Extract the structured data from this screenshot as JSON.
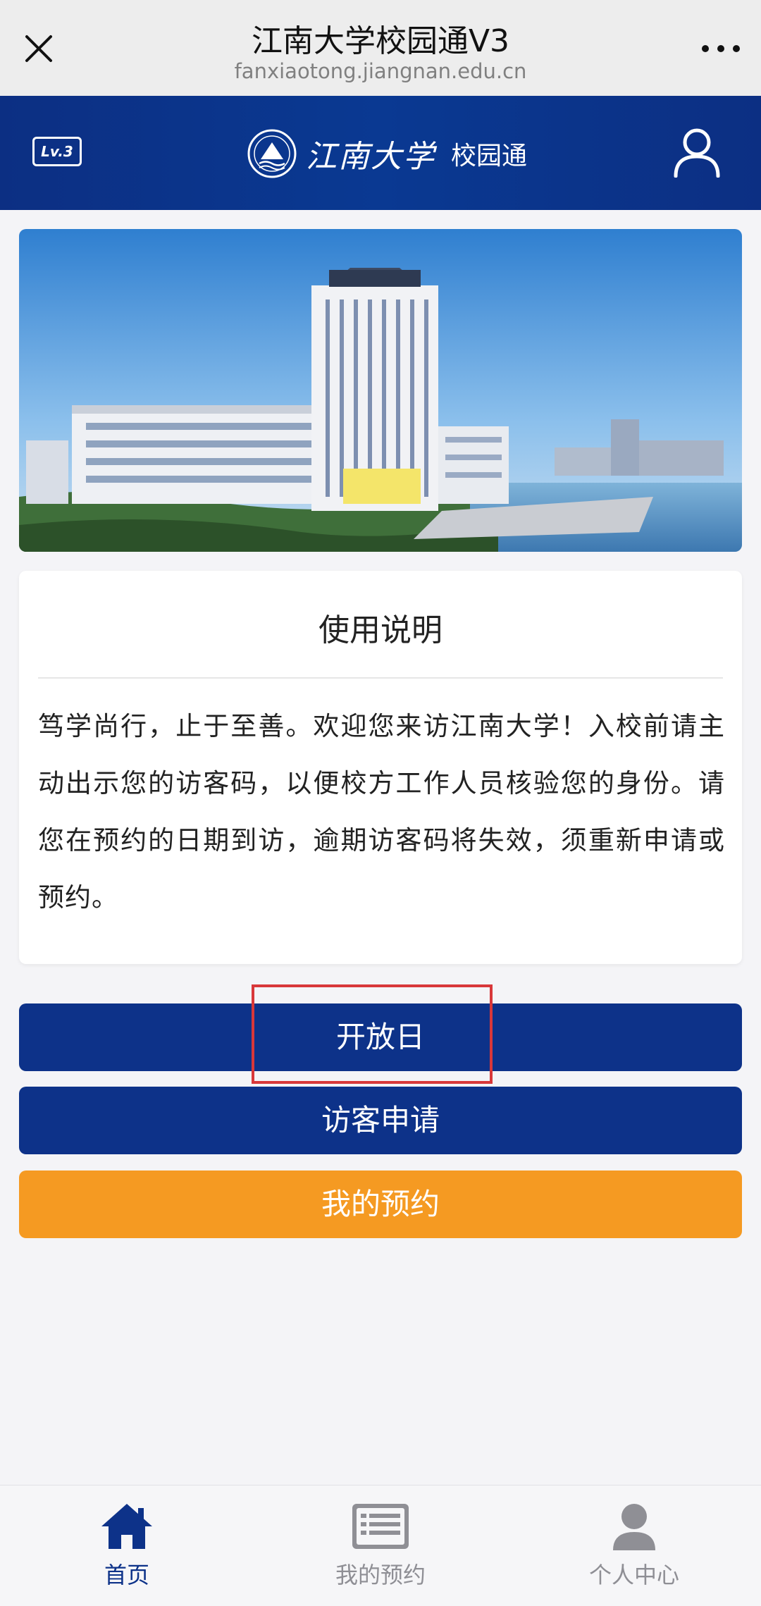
{
  "topbar": {
    "title": "江南大学校园通V3",
    "url": "fanxiaotong.jiangnan.edu.cn"
  },
  "header": {
    "level_badge": "Lv.3",
    "logo_text": "江南大学",
    "app_name": "校园通"
  },
  "instructions": {
    "title": "使用说明",
    "body": "笃学尚行，止于至善。欢迎您来访江南大学！入校前请主动出示您的访客码，以便校方工作人员核验您的身份。请您在预约的日期到访，逾期访客码将失效，须重新申请或预约。"
  },
  "buttons": {
    "open_day": "开放日",
    "visitor_apply": "访客申请",
    "my_appointments": "我的预约"
  },
  "bottom_nav": {
    "home": "首页",
    "appointments": "我的预约",
    "personal": "个人中心"
  },
  "colors": {
    "primary_blue": "#0d3289",
    "accent_orange": "#f59a22",
    "highlight_red": "#d8383a"
  }
}
